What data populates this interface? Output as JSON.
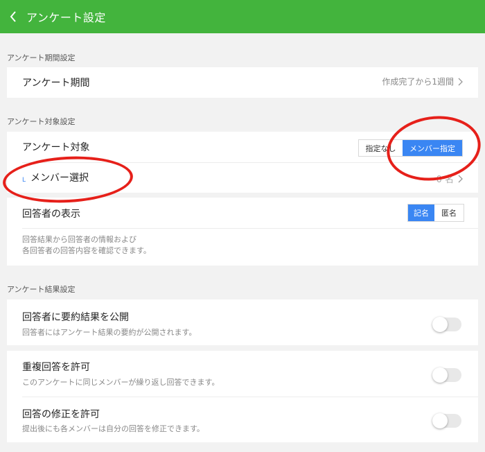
{
  "header": {
    "title": "アンケート設定",
    "back_icon": "chevron-left-icon",
    "bg_color": "#43b43d"
  },
  "sections": {
    "period": {
      "label": "アンケート期間設定",
      "row_title": "アンケート期間",
      "row_value": "作成完了から1週間"
    },
    "target": {
      "label": "アンケート対象設定",
      "target_title": "アンケート対象",
      "target_options": [
        "指定なし",
        "メンバー指定"
      ],
      "target_selected": "メンバー指定",
      "member_select_mark": "L",
      "member_select_title": "メンバー選択",
      "member_count": "0 名",
      "display_title": "回答者の表示",
      "display_options": [
        "記名",
        "匿名"
      ],
      "display_selected": "記名",
      "display_desc_line1": "回答結果から回答者の情報および",
      "display_desc_line2": "各回答者の回答内容を確認できます。"
    },
    "result": {
      "label": "アンケート結果設定",
      "publish_title": "回答者に要約結果を公開",
      "publish_desc": "回答者にはアンケート結果の要約が公開されます。",
      "publish_on": false,
      "duplicate_title": "重複回答を許可",
      "duplicate_desc": "このアンケートに同じメンバーが繰り返し回答できます。",
      "duplicate_on": false,
      "edit_title": "回答の修正を許可",
      "edit_desc": "提出後にも各メンバーは自分の回答を修正できます。",
      "edit_on": false
    }
  },
  "colors": {
    "accent_blue": "#3a86f3",
    "annotation_red": "#e6201a"
  }
}
